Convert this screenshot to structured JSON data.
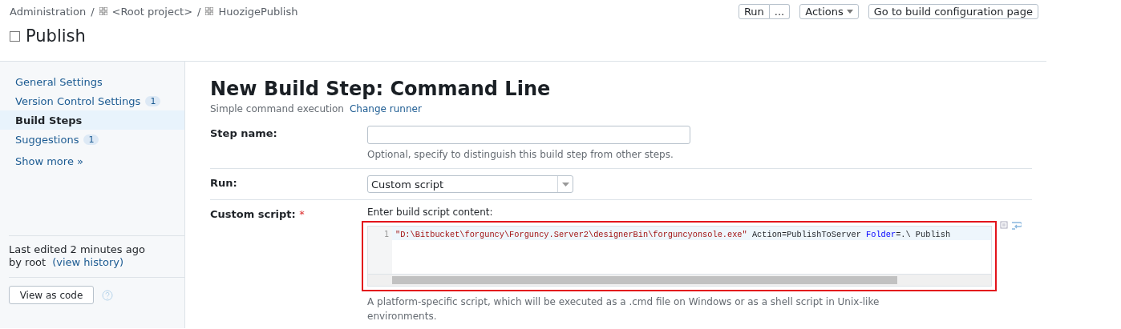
{
  "breadcrumbs": [
    {
      "label": "Administration",
      "icon": false
    },
    {
      "label": "<Root project>",
      "icon": true
    },
    {
      "label": "HuozigePublish",
      "icon": true
    }
  ],
  "separator": "/",
  "title": "Publish",
  "header_buttons": [
    {
      "kind": "split",
      "label": "Run",
      "extra": "..."
    },
    {
      "kind": "dropdown",
      "label": "Actions"
    },
    {
      "kind": "plain",
      "label": "Go to build configuration page"
    }
  ],
  "sidebar": {
    "items": [
      {
        "label": "General Settings",
        "selected": false
      },
      {
        "label": "Version Control Settings",
        "badge": "1",
        "selected": false
      },
      {
        "label": "Build Steps",
        "selected": true
      },
      {
        "label": "Suggestions",
        "badge": "1",
        "selected": false
      }
    ],
    "show_more": "Show more »",
    "last_edited": "Last edited 2 minutes ago",
    "by": "by root",
    "history_link": "(view history)",
    "view_as_code": "View as code"
  },
  "page": {
    "heading": "New Build Step: Command Line",
    "subtitle": "Simple command execution",
    "change_runner": "Change runner",
    "step_name": {
      "label": "Step name:",
      "hint": "Optional, specify to distinguish this build step from other steps."
    },
    "run": {
      "label": "Run:",
      "value": "Custom script"
    },
    "script": {
      "label": "Custom script:",
      "required": "*",
      "prompt": "Enter build script content:",
      "line_number": "1",
      "highlighted": true,
      "tokens": [
        {
          "kind": "string",
          "text": "\"D:\\Bitbucket\\forguncy\\Forguncy.Server2\\designerBin\\forguncyonsole.exe\""
        },
        {
          "kind": "plain",
          "text": " Action=PublishToServer "
        },
        {
          "kind": "keyword",
          "text": "Folder"
        },
        {
          "kind": "plain",
          "text": "=.\\ Publish"
        }
      ],
      "hint": "A platform-specific script, which will be executed as a .cmd file on Windows or as a shell script in Unix-like environments."
    }
  }
}
